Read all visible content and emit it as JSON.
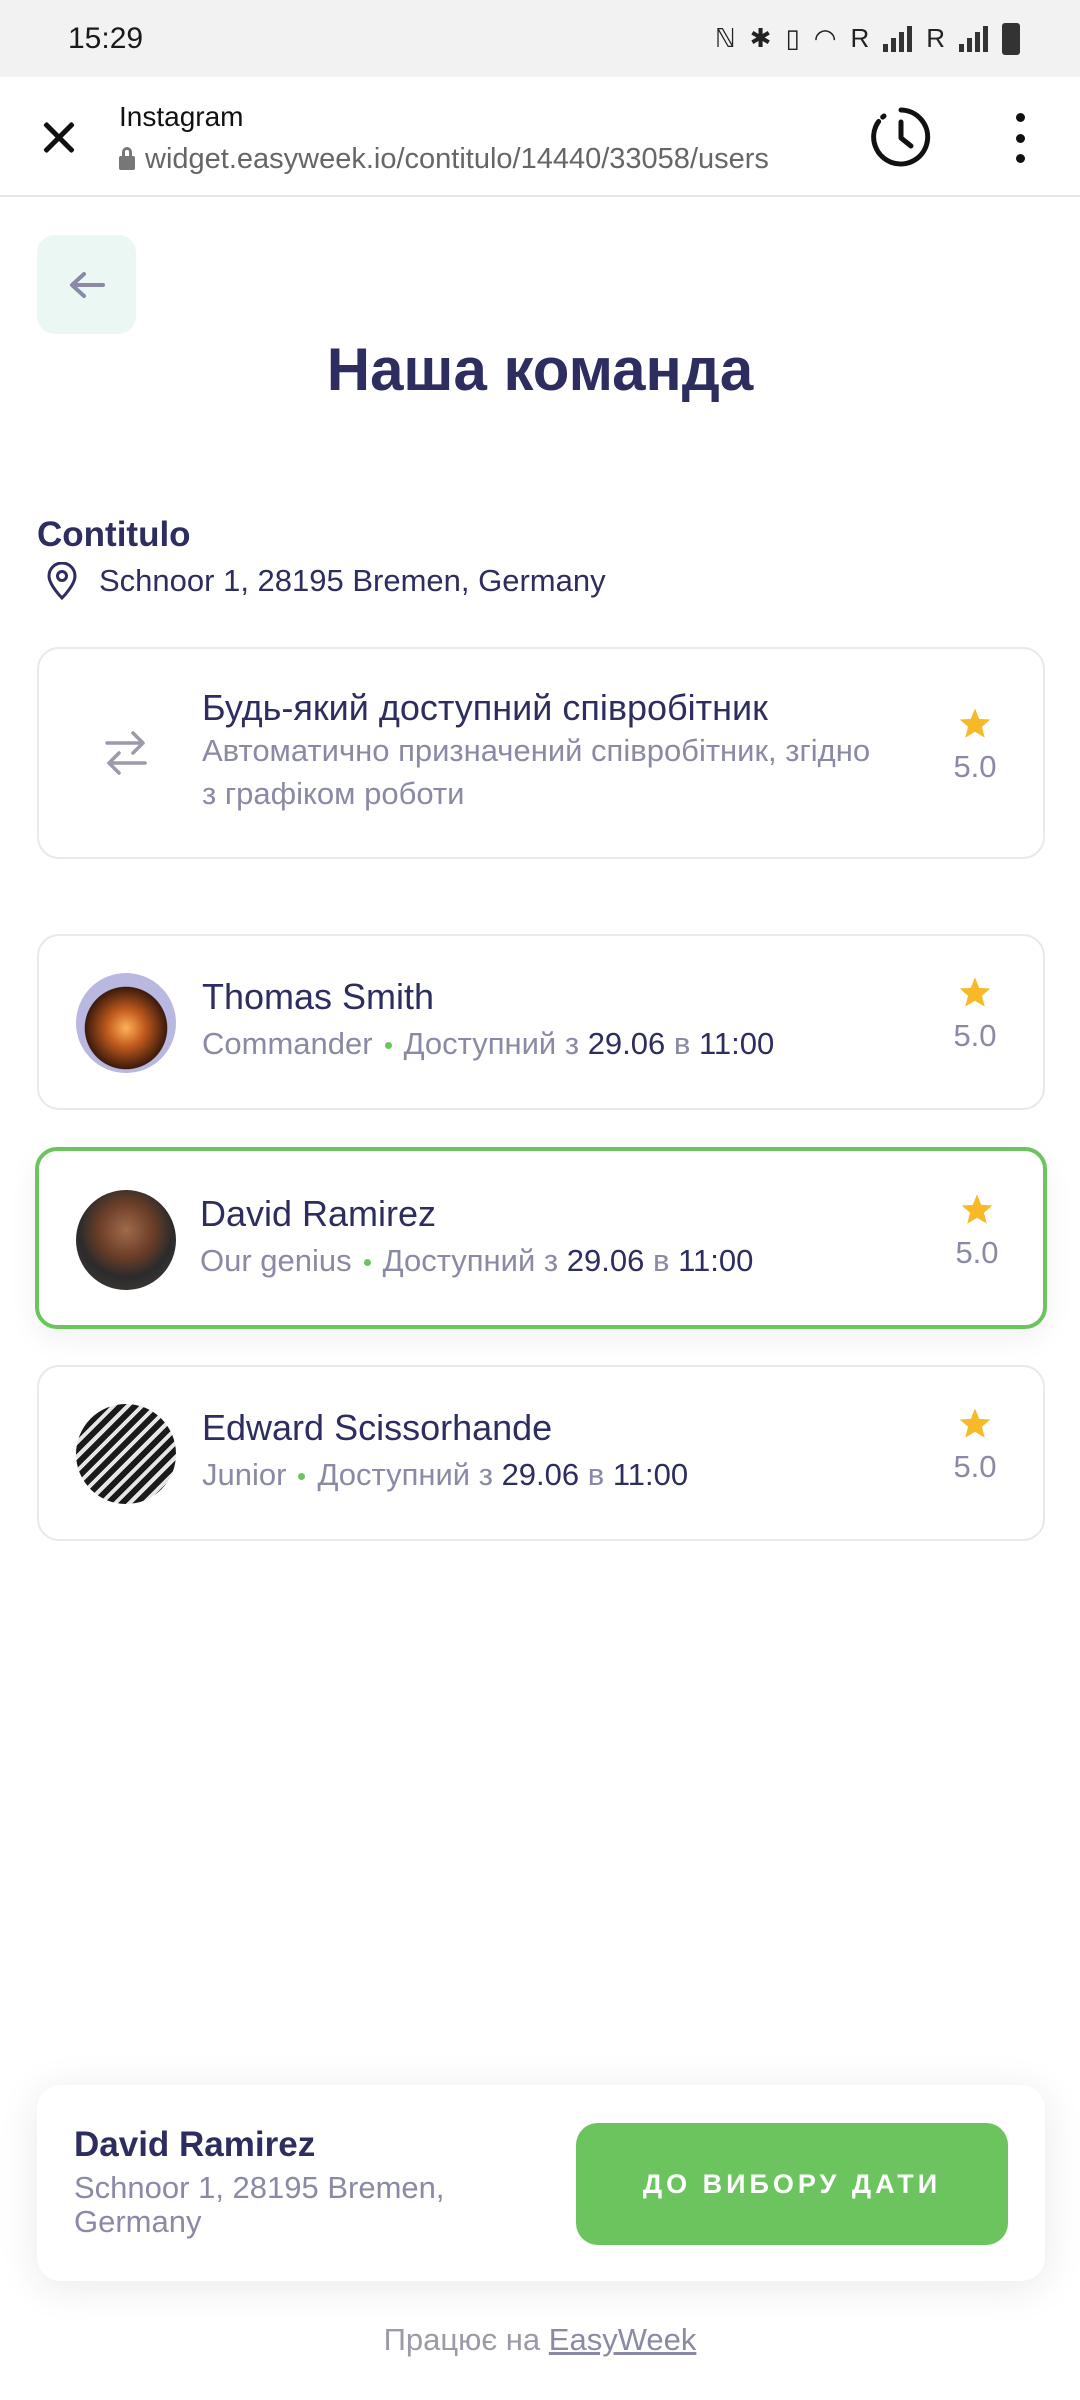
{
  "status_bar": {
    "time": "15:29",
    "carrier1": "R",
    "carrier2": "R"
  },
  "browser": {
    "title": "Instagram",
    "url": "widget.easyweek.io/contitulo/14440/33058/users"
  },
  "page": {
    "title": "Наша команда"
  },
  "location": {
    "name": "Contitulo",
    "address": "Schnoor 1, 28195 Bremen, Germany"
  },
  "any_employee": {
    "title": "Будь-який доступний співробітник",
    "description_line1": "Автоматично призначений співробітник, згідно",
    "description_line2": "з графіком роботи",
    "rating": "5.0"
  },
  "employees": [
    {
      "name": "Thomas Smith",
      "role": "Commander",
      "available_prefix": "Доступний з",
      "date": "29.06",
      "at": "в",
      "time": "11:00",
      "rating": "5.0"
    },
    {
      "name": "David Ramirez",
      "role": "Our genius",
      "available_prefix": "Доступний з",
      "date": "29.06",
      "at": "в",
      "time": "11:00",
      "rating": "5.0"
    },
    {
      "name": "Edward Scissorhande",
      "role": "Junior",
      "available_prefix": "Доступний з",
      "date": "29.06",
      "at": "в",
      "time": "11:00",
      "rating": "5.0"
    }
  ],
  "summary": {
    "name": "David Ramirez",
    "address": "Schnoor 1, 28195 Bremen, Germany",
    "button_label": "ДО ВИБОРУ ДАТИ"
  },
  "footer": {
    "prefix": "Працює на",
    "link": "EasyWeek"
  },
  "colors": {
    "accent": "#6cc45e",
    "text": "#2d2d5f",
    "muted": "#8a8aa6",
    "star": "#f7b928"
  }
}
